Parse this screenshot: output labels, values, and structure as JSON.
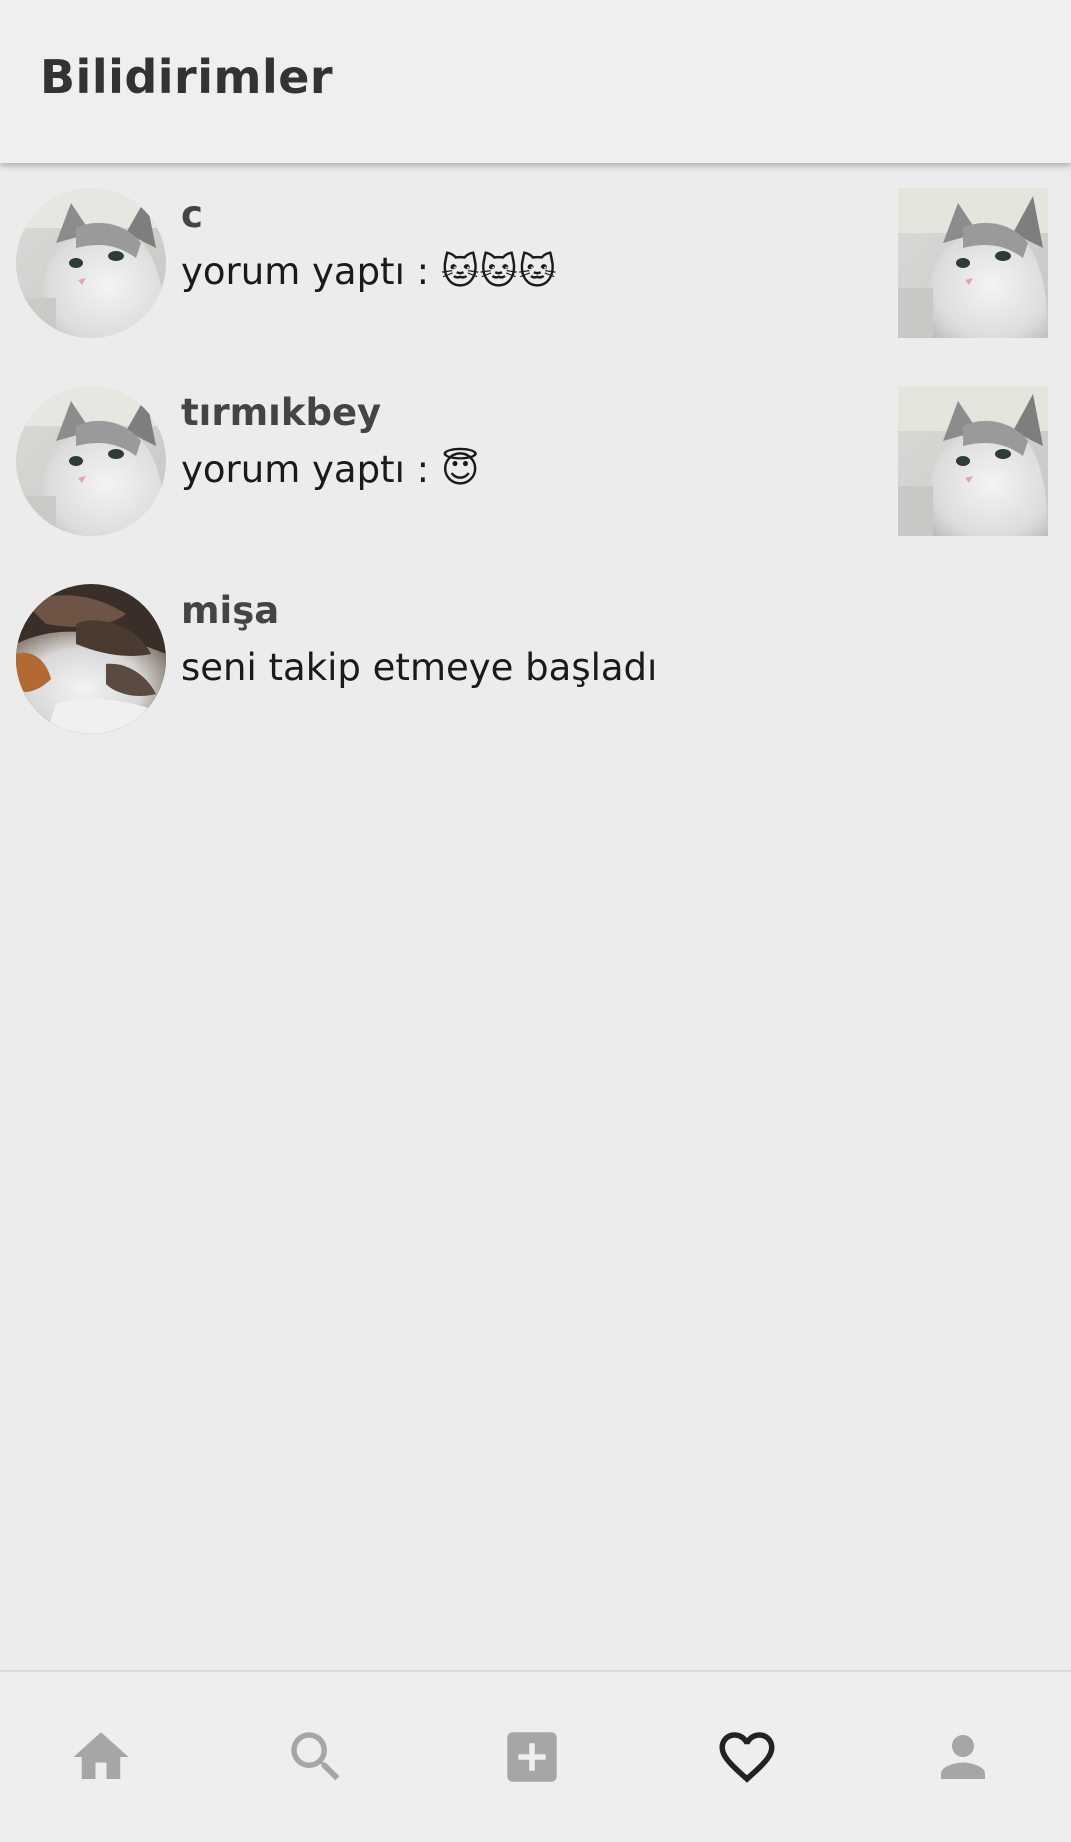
{
  "header": {
    "title": "Bilidirimler"
  },
  "notifications": [
    {
      "username": "c",
      "message": "yorum yaptı : 🐱🐱🐱",
      "avatar_icon": "cat-photo-white",
      "has_thumbnail": true
    },
    {
      "username": "tırmıkbey",
      "message": "yorum yaptı : 😇",
      "avatar_icon": "cat-photo-white",
      "has_thumbnail": true
    },
    {
      "username": "mişa",
      "message": "seni takip etmeye başladı",
      "avatar_icon": "cat-photo-calico",
      "has_thumbnail": false
    }
  ],
  "bottom_nav": {
    "items": [
      {
        "icon": "home-icon",
        "active": false
      },
      {
        "icon": "search-icon",
        "active": false
      },
      {
        "icon": "add-post-icon",
        "active": false
      },
      {
        "icon": "heart-icon",
        "active": true
      },
      {
        "icon": "profile-icon",
        "active": false
      }
    ]
  },
  "colors": {
    "background": "#ececec",
    "app_bar": "#efefef",
    "title_text": "#333333",
    "username_text": "#444444",
    "message_text": "#1a1a1a",
    "nav_inactive": "#a6a6a6",
    "nav_active": "#222222"
  }
}
